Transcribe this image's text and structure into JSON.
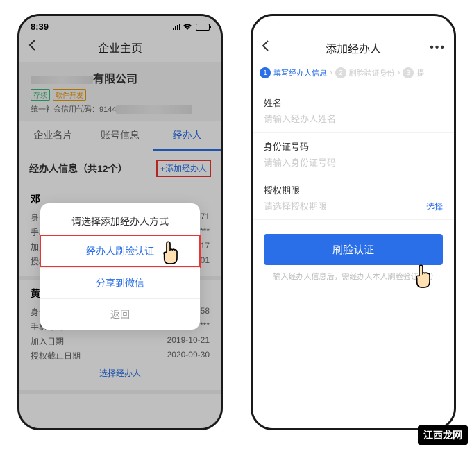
{
  "left": {
    "statusbar": {
      "time": "8:39"
    },
    "header": {
      "title": "企业主页"
    },
    "company": {
      "name_suffix": "有限公司",
      "tag1": "存续",
      "tag2": "软件开发",
      "credit_label": "统一社会信用代码：",
      "credit_prefix": "9144"
    },
    "tabs": {
      "t1": "企业名片",
      "t2": "账号信息",
      "t3": "经办人"
    },
    "section": {
      "title": "经办人信息（共12个）",
      "add": "+添加经办人"
    },
    "modal": {
      "title": "请选择添加经办人方式",
      "opt1": "经办人刷脸认证",
      "opt2": "分享到微信",
      "cancel": "返回"
    },
    "card1": {
      "name_prefix": "邓",
      "r1_label": "身份",
      "r1_val_suffix": "871",
      "r2_label": "手机",
      "r2_val_suffix": "***",
      "r3_label": "加入",
      "r3_val_suffix": "-17",
      "r4_label": "授权",
      "r4_val_suffix": "-01"
    },
    "card2": {
      "name": "黄权军",
      "r1_label": "身份证号码",
      "r1_val": "440***********858",
      "r2_label": "手机号码",
      "r2_val": "133********",
      "r3_label": "加入日期",
      "r3_val": "2019-10-21",
      "r4_label": "授权截止日期",
      "r4_val": "2020-09-30",
      "select": "选择经办人"
    }
  },
  "right": {
    "header": {
      "title": "添加经办人"
    },
    "steps": {
      "s1": "填写经办人信息",
      "s2": "刷脸验证身份",
      "s3": "提"
    },
    "form": {
      "f1_label": "姓名",
      "f1_ph": "请输入经办人姓名",
      "f2_label": "身份证号码",
      "f2_ph": "请输入身份证号码",
      "f3_label": "授权期限",
      "f3_ph": "请选择授权期限",
      "f3_select": "选择"
    },
    "button": "刷脸认证",
    "hint": "输入经办人信息后，需经办人本人刷脸验证身份"
  },
  "watermark": "江西龙网"
}
